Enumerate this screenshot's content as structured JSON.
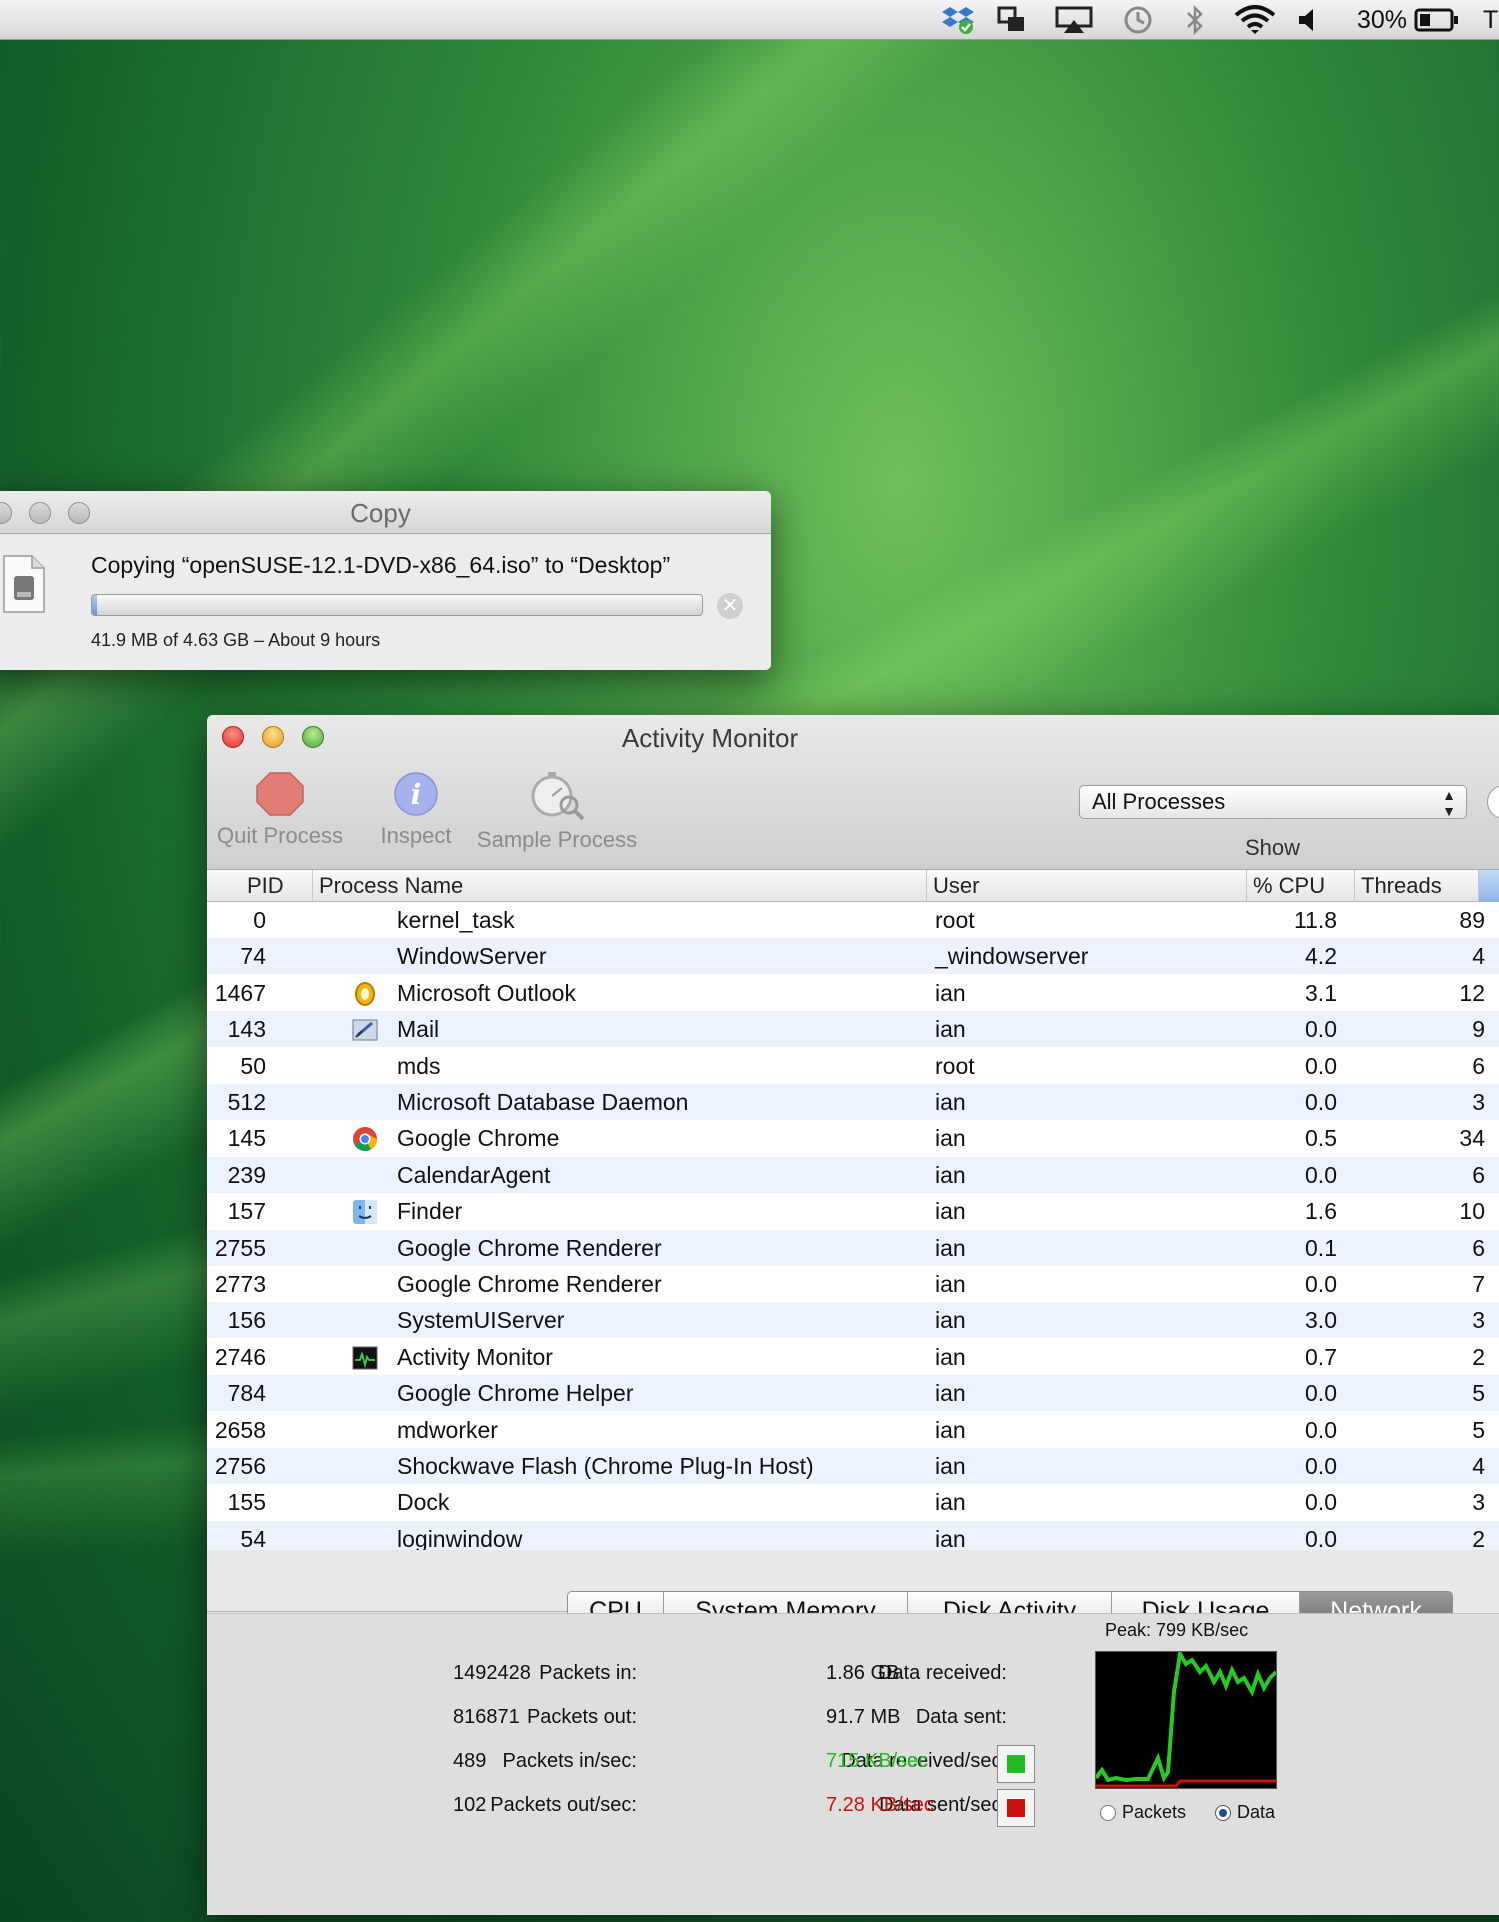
{
  "menubar": {
    "icons": [
      "dropbox-icon",
      "display-mirroring-icon",
      "airplay-icon",
      "time-machine-icon",
      "bluetooth-icon",
      "wifi-icon",
      "volume-icon",
      "battery-icon"
    ],
    "battery_percent": "30%",
    "trailing_text": "T"
  },
  "copy_window": {
    "title": "Copy",
    "message": "Copying “openSUSE-12.1-DVD-x86_64.iso” to “Desktop”",
    "progress_fraction": 0.009,
    "status": "41.9 MB of 4.63 GB – About 9 hours"
  },
  "activity_monitor": {
    "title": "Activity Monitor",
    "toolbar": {
      "quit_label": "Quit Process",
      "inspect_label": "Inspect",
      "sample_label": "Sample Process",
      "show_label": "Show",
      "filter_value": "All Processes"
    },
    "columns": [
      "PID",
      "Process Name",
      "User",
      "% CPU",
      "Threads"
    ],
    "processes": [
      {
        "pid": "0",
        "name": "kernel_task",
        "user": "root",
        "cpu": "11.8",
        "threads": "89",
        "icon": ""
      },
      {
        "pid": "74",
        "name": "WindowServer",
        "user": "_windowserver",
        "cpu": "4.2",
        "threads": "4",
        "icon": ""
      },
      {
        "pid": "1467",
        "name": "Microsoft Outlook",
        "user": "ian",
        "cpu": "3.1",
        "threads": "12",
        "icon": "outlook-icon"
      },
      {
        "pid": "143",
        "name": "Mail",
        "user": "ian",
        "cpu": "0.0",
        "threads": "9",
        "icon": "mail-icon"
      },
      {
        "pid": "50",
        "name": "mds",
        "user": "root",
        "cpu": "0.0",
        "threads": "6",
        "icon": ""
      },
      {
        "pid": "512",
        "name": "Microsoft Database Daemon",
        "user": "ian",
        "cpu": "0.0",
        "threads": "3",
        "icon": ""
      },
      {
        "pid": "145",
        "name": "Google Chrome",
        "user": "ian",
        "cpu": "0.5",
        "threads": "34",
        "icon": "chrome-icon"
      },
      {
        "pid": "239",
        "name": "CalendarAgent",
        "user": "ian",
        "cpu": "0.0",
        "threads": "6",
        "icon": ""
      },
      {
        "pid": "157",
        "name": "Finder",
        "user": "ian",
        "cpu": "1.6",
        "threads": "10",
        "icon": "finder-icon"
      },
      {
        "pid": "2755",
        "name": "Google Chrome Renderer",
        "user": "ian",
        "cpu": "0.1",
        "threads": "6",
        "icon": ""
      },
      {
        "pid": "2773",
        "name": "Google Chrome Renderer",
        "user": "ian",
        "cpu": "0.0",
        "threads": "7",
        "icon": ""
      },
      {
        "pid": "156",
        "name": "SystemUIServer",
        "user": "ian",
        "cpu": "3.0",
        "threads": "3",
        "icon": ""
      },
      {
        "pid": "2746",
        "name": "Activity Monitor",
        "user": "ian",
        "cpu": "0.7",
        "threads": "2",
        "icon": "activity-monitor-icon"
      },
      {
        "pid": "784",
        "name": "Google Chrome Helper",
        "user": "ian",
        "cpu": "0.0",
        "threads": "5",
        "icon": ""
      },
      {
        "pid": "2658",
        "name": "mdworker",
        "user": "ian",
        "cpu": "0.0",
        "threads": "5",
        "icon": ""
      },
      {
        "pid": "2756",
        "name": "Shockwave Flash (Chrome Plug-In Host)",
        "user": "ian",
        "cpu": "0.0",
        "threads": "4",
        "icon": ""
      },
      {
        "pid": "155",
        "name": "Dock",
        "user": "ian",
        "cpu": "0.0",
        "threads": "3",
        "icon": ""
      },
      {
        "pid": "54",
        "name": "loginwindow",
        "user": "ian",
        "cpu": "0.0",
        "threads": "2",
        "icon": ""
      }
    ],
    "tabs": [
      "CPU",
      "System Memory",
      "Disk Activity",
      "Disk Usage",
      "Network"
    ],
    "selected_tab": "Network",
    "network": {
      "packets_in_label": "Packets in:",
      "packets_in": "1492428",
      "packets_out_label": "Packets out:",
      "packets_out": "816871",
      "packets_in_sec_label": "Packets in/sec:",
      "packets_in_sec": "489",
      "packets_out_sec_label": "Packets out/sec:",
      "packets_out_sec": "102",
      "data_received_label": "Data received:",
      "data_received": "1.86 GB",
      "data_sent_label": "Data sent:",
      "data_sent": "91.7 MB",
      "data_received_sec_label": "Data received/sec:",
      "data_received_sec": "715 KB/sec",
      "data_sent_sec_label": "Data sent/sec:",
      "data_sent_sec": "7.28 KB/sec",
      "received_color": "#22bb22",
      "sent_color": "#cc1111",
      "peak_label": "Peak: 799 KB/sec",
      "radio_packets_label": "Packets",
      "radio_data_label": "Data",
      "selected_radio": "Data"
    }
  }
}
